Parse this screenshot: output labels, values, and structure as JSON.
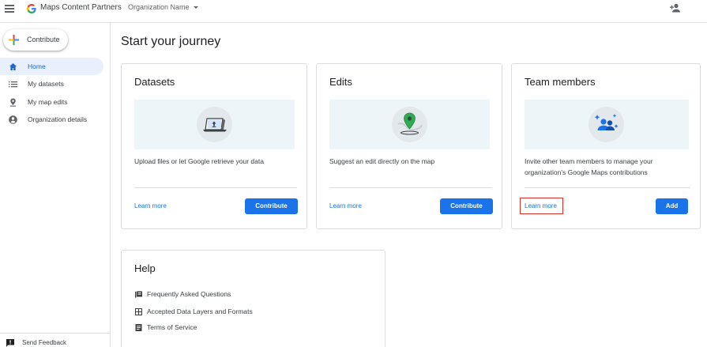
{
  "header": {
    "app_title": "Maps Content Partners",
    "org_name": "Organization Name"
  },
  "sidebar": {
    "contribute_label": "Contribute",
    "items": [
      {
        "label": "Home",
        "icon": "home-icon",
        "active": true
      },
      {
        "label": "My datasets",
        "icon": "list-icon",
        "active": false
      },
      {
        "label": "My map edits",
        "icon": "pin-icon",
        "active": false
      },
      {
        "label": "Organization details",
        "icon": "account-icon",
        "active": false
      }
    ],
    "feedback_label": "Send Feedback"
  },
  "main": {
    "title": "Start your journey",
    "cards": [
      {
        "title": "Datasets",
        "description": "Upload files or let Google retrieve your data",
        "learn_more": "Learn more",
        "button": "Contribute",
        "illustration": "laptop-upload-icon"
      },
      {
        "title": "Edits",
        "description": "Suggest an edit directly on the map",
        "learn_more": "Learn more",
        "button": "Contribute",
        "illustration": "map-pin-globe-icon"
      },
      {
        "title": "Team members",
        "description": "Invite other team members to manage your organization’s Google Maps contributions",
        "learn_more": "Learn more",
        "button": "Add",
        "illustration": "people-sparkle-icon"
      }
    ],
    "help": {
      "title": "Help",
      "links": [
        {
          "label": "Frequently Asked Questions",
          "icon": "book-icon"
        },
        {
          "label": "Accepted Data Layers and Formats",
          "icon": "table-icon"
        },
        {
          "label": "Terms of Service",
          "icon": "document-icon"
        }
      ]
    }
  },
  "colors": {
    "accent": "#1a73e8",
    "active_nav_bg": "#e8f0fe",
    "highlight_box": "#d93025"
  }
}
